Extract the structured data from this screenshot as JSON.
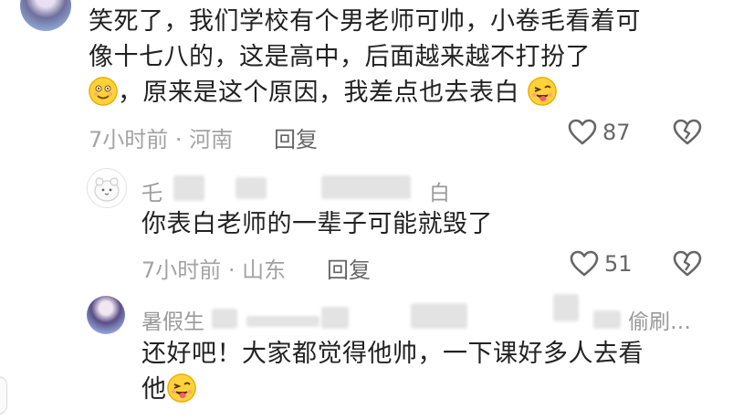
{
  "main_comment": {
    "text_line1": "笑死了，我们学校有个男老师可帅，小卷毛看着可",
    "text_line2": "像十七八的，这是高中，后面越来越不打扮了",
    "text_line3": "，原来是这个原因，我差点也去表白",
    "meta": "7小时前 · 河南",
    "reply_label": "回复",
    "likes": "87"
  },
  "reply_1": {
    "username_prefix": "乇",
    "username_suffix": "白",
    "text": "你表白老师的一辈子可能就毁了",
    "meta": "7小时前 · 山东",
    "reply_label": "回复",
    "likes": "51"
  },
  "reply_2": {
    "username_prefix": "暑假生",
    "username_suffix": "偷刷…",
    "text_line1": "还好吧！大家都觉得他帅，一下课好多人去看",
    "text_line2": "他",
    "meta": "",
    "reply_label": "",
    "likes": ""
  },
  "icons": {
    "like": "heart-outline-icon",
    "dislike": "broken-heart-icon",
    "emoji_smile": "smiling-face-emoji",
    "emoji_wink": "winking-tongue-face-emoji"
  },
  "colors": {
    "text": "#222222",
    "meta": "#a3a3a3",
    "action": "#666666"
  }
}
